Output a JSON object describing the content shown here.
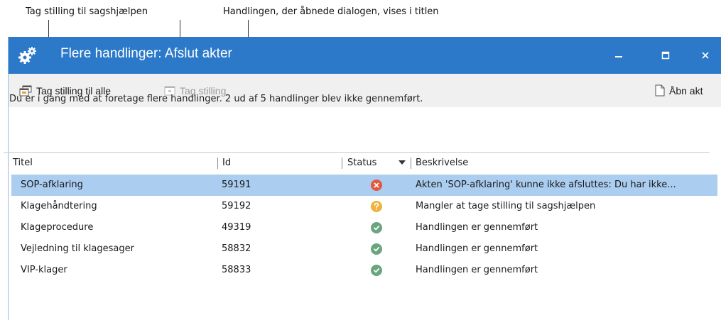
{
  "callouts": {
    "left": "Tag stilling til sagshjælpen",
    "right": "Handlingen, der åbnede dialogen, vises i titlen"
  },
  "window": {
    "title": "Flere handlinger: Afslut akter",
    "icon": "gears-icon",
    "accent": "#2b79c8"
  },
  "toolbar": {
    "take_all_label": "Tag stilling til alle",
    "take_label": "Tag stilling",
    "open_label": "Åbn akt"
  },
  "message": "Du er i gang med at foretage flere handlinger. 2 ud af 5 handlinger blev ikke gennemført.",
  "columns": {
    "title": "Titel",
    "id": "Id",
    "status": "Status",
    "description": "Beskrivelse"
  },
  "rows": [
    {
      "title": "SOP-afklaring",
      "id": "59191",
      "status": "error",
      "description": "Akten 'SOP-afklaring' kunne ikke afsluttes: Du har ikke...",
      "selected": true
    },
    {
      "title": "Klagehåndtering",
      "id": "59192",
      "status": "question",
      "description": "Mangler at tage stilling til sagshjælpen",
      "selected": false
    },
    {
      "title": "Klageprocedure",
      "id": "49319",
      "status": "ok",
      "description": "Handlingen er gennemført",
      "selected": false
    },
    {
      "title": "Vejledning til klagesager",
      "id": "58832",
      "status": "ok",
      "description": "Handlingen er gennemført",
      "selected": false
    },
    {
      "title": "VIP-klager",
      "id": "58833",
      "status": "ok",
      "description": "Handlingen er gennemført",
      "selected": false
    }
  ],
  "status_colors": {
    "error": "#e3583e",
    "question": "#f0b23e",
    "ok": "#6aa57e"
  }
}
